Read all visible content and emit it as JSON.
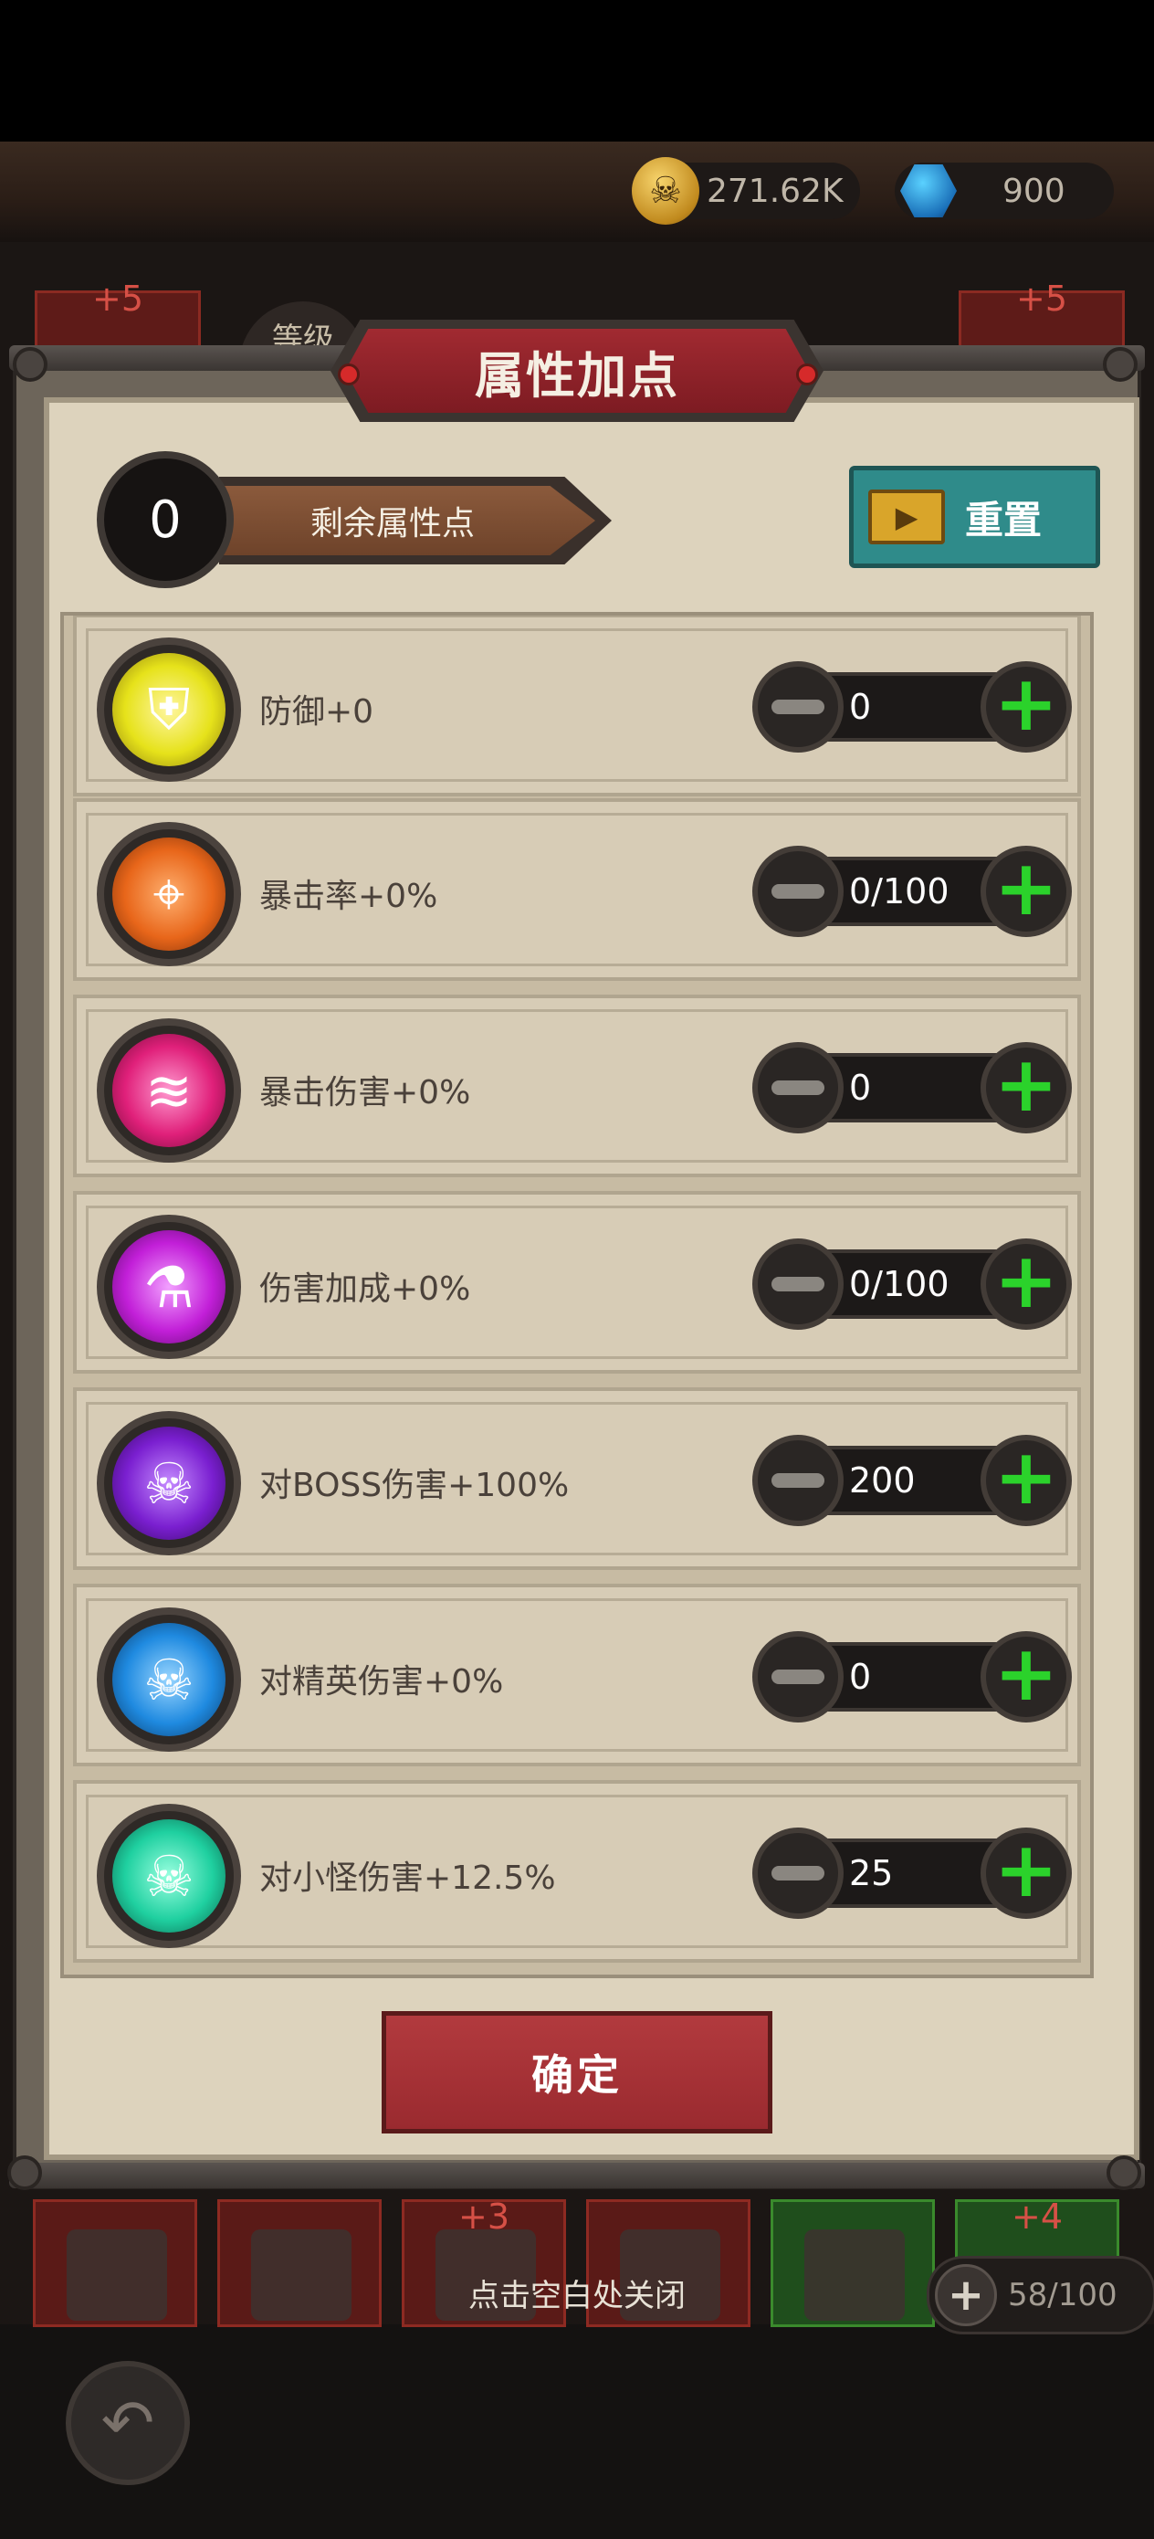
{
  "topbar": {
    "coins": "271.62K",
    "gems": "900",
    "coin_icon": "skull-coin-icon",
    "gem_icon": "blue-gem-icon"
  },
  "background": {
    "level_label": "等级",
    "left_badge": "+5",
    "right_badge": "+5",
    "equip_badges": [
      "+3",
      "+4"
    ],
    "close_hint": "点击空白处关闭",
    "capacity": "58/100"
  },
  "dialog": {
    "title": "属性加点",
    "remaining_points": "0",
    "remaining_label": "剩余属性点",
    "reset_label": "重置",
    "confirm_label": "确定",
    "stats": [
      {
        "label": "防御+0",
        "value": "0",
        "icon": "shield-icon",
        "color": "#e6e21a"
      },
      {
        "label": "暴击率+0%",
        "value": "0/100",
        "icon": "crosshair-icon",
        "color": "#e8661a"
      },
      {
        "label": "暴击伤害+0%",
        "value": "0",
        "icon": "claw-slash-icon",
        "color": "#e0207a"
      },
      {
        "label": "伤害加成+0%",
        "value": "0/100",
        "icon": "potion-bottles-icon",
        "color": "#c21fd8"
      },
      {
        "label": "对BOSS伤害+100%",
        "value": "200",
        "icon": "horned-skull-icon",
        "color": "#7a1fd0"
      },
      {
        "label": "对精英伤害+0%",
        "value": "0",
        "icon": "elite-skull-icon",
        "color": "#1f8ae0"
      },
      {
        "label": "对小怪伤害+12.5%",
        "value": "25",
        "icon": "minion-skull-icon",
        "color": "#1fd0a0"
      }
    ]
  }
}
